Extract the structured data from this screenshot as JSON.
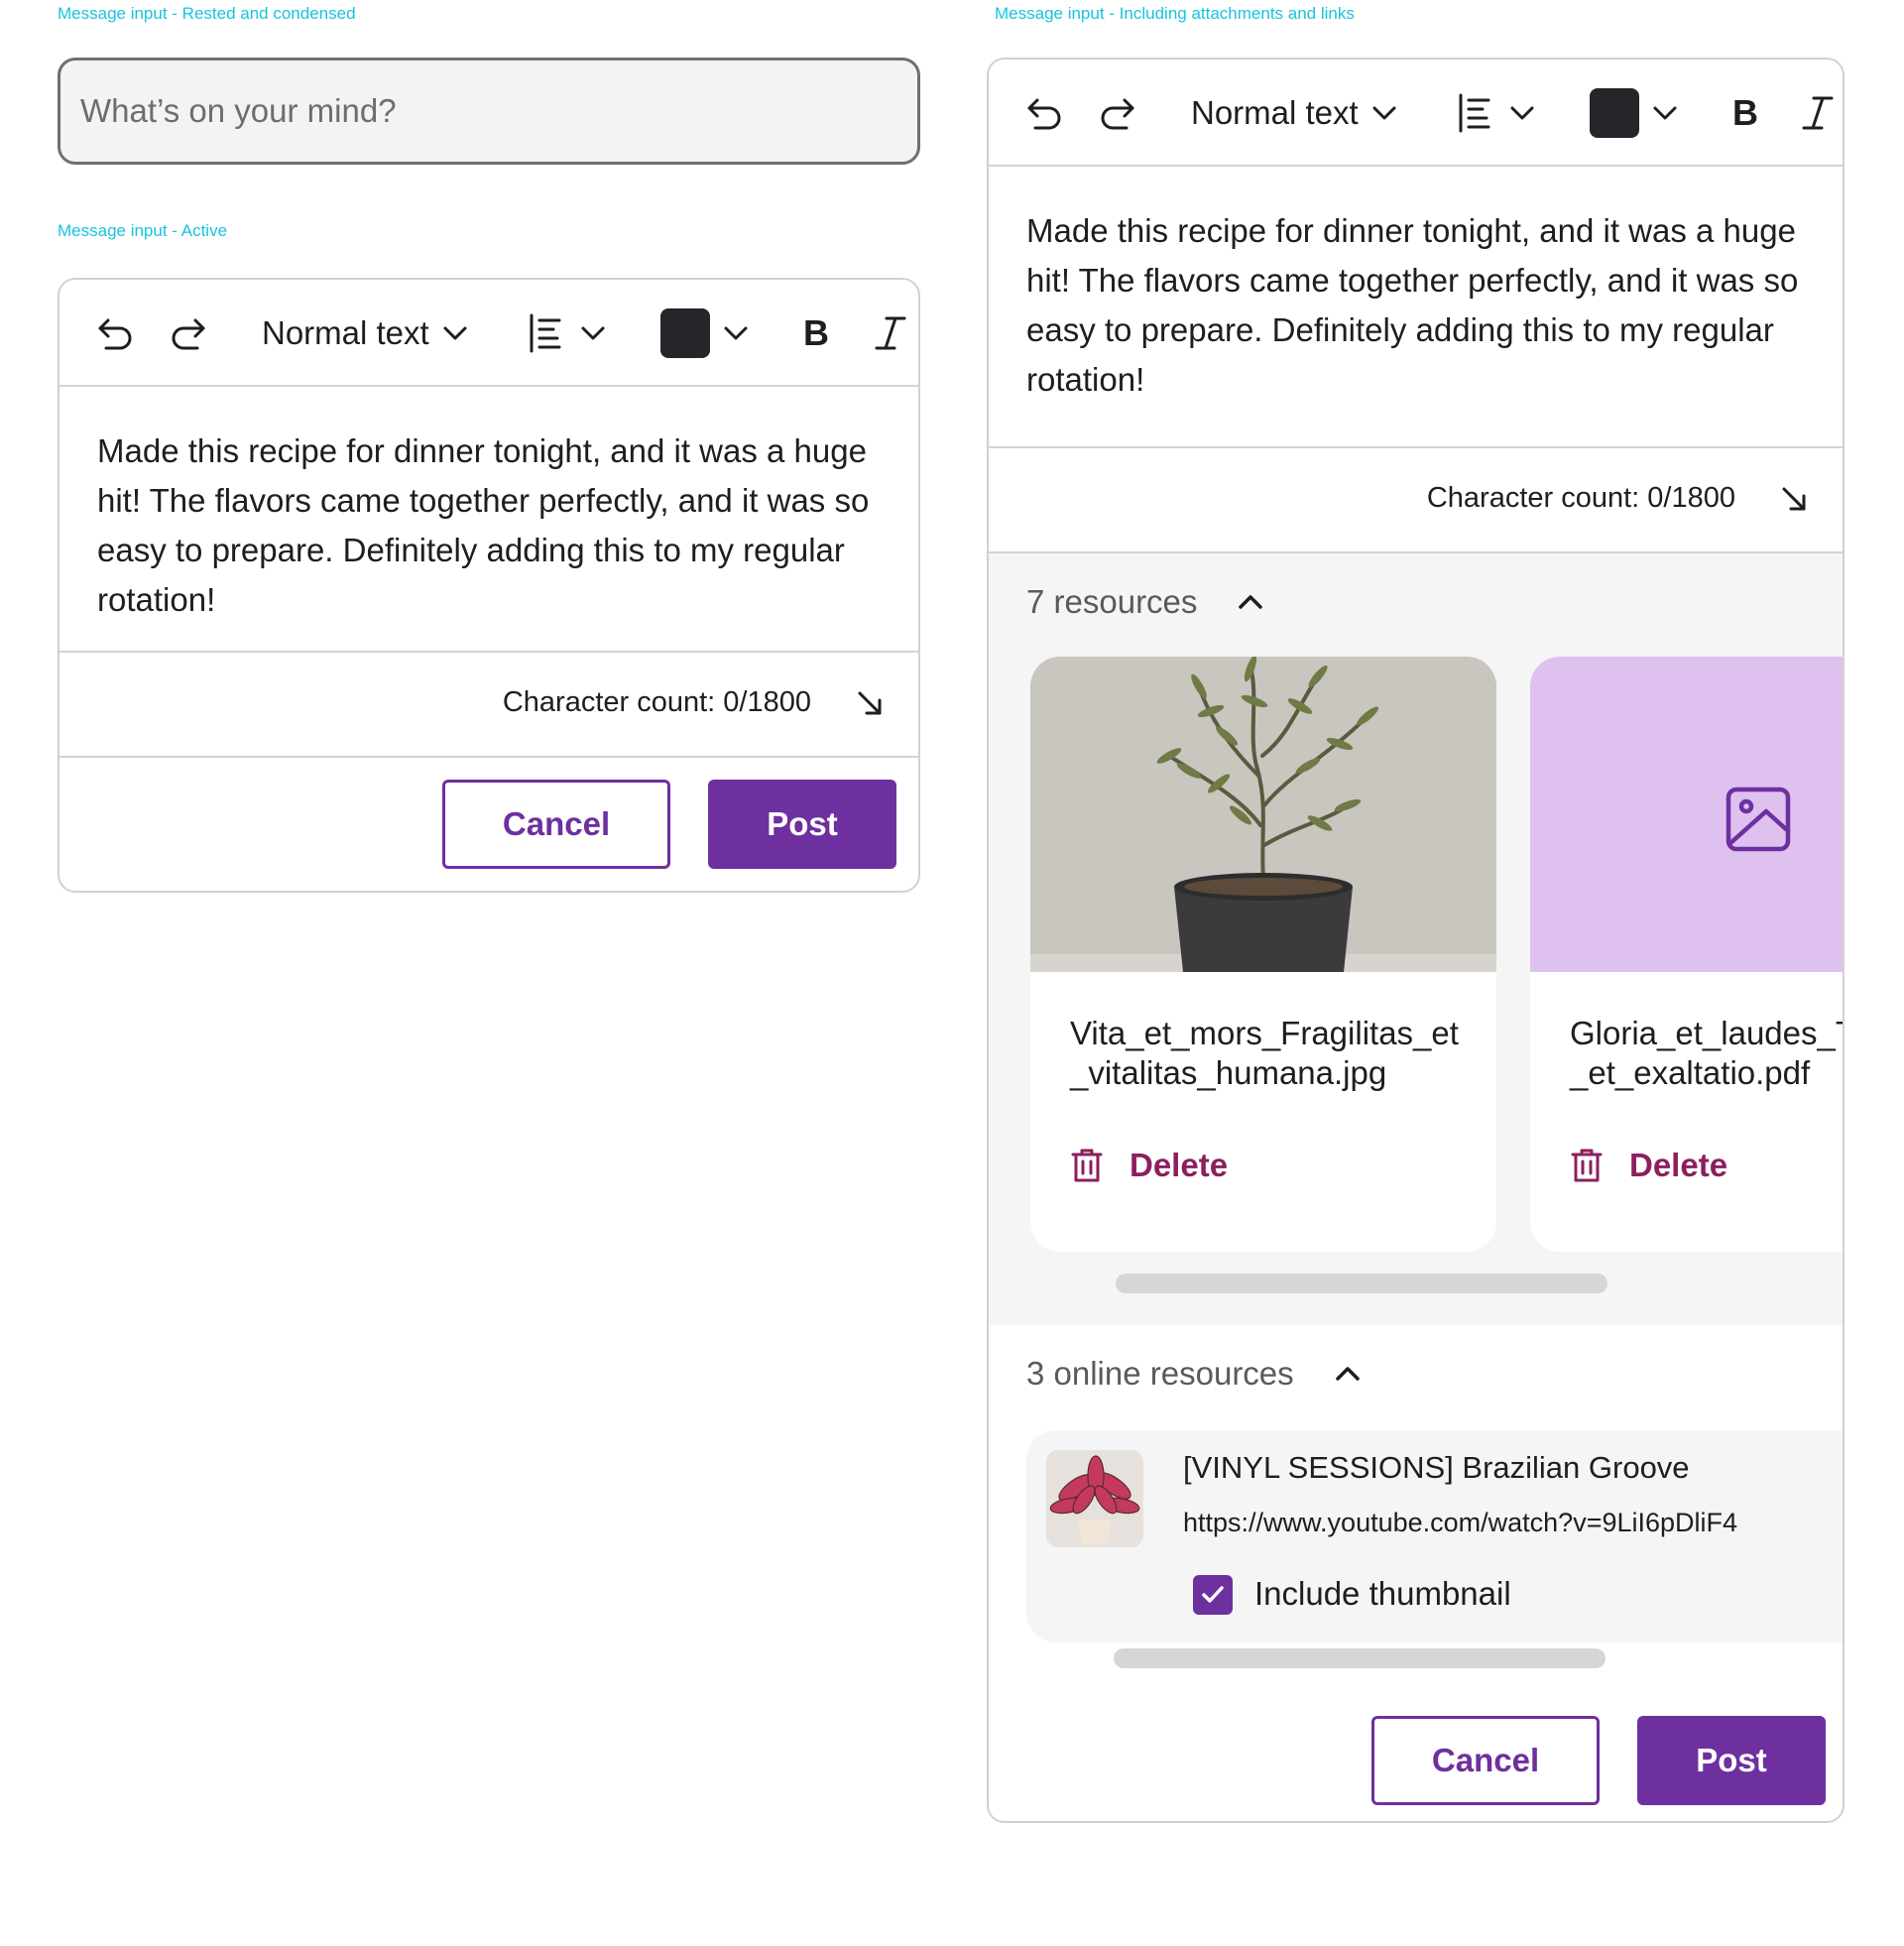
{
  "labels": {
    "rested": "Message input - Rested and condensed",
    "active": "Message input - Active",
    "attachments": "Message input - Including attachments and links"
  },
  "rested_input": {
    "placeholder": "What’s on your mind?"
  },
  "toolbar": {
    "text_style": "Normal text",
    "bold": "B",
    "italic": "I",
    "text_color": "#25252a"
  },
  "message": {
    "lines": [
      "Made this recipe for dinner tonight, and it was a huge",
      "hit! The flavors came together perfectly, and it was so",
      "easy to prepare. Definitely adding this to my regular",
      "rotation!"
    ]
  },
  "char_count": "Character count: 0/1800",
  "buttons": {
    "cancel": "Cancel",
    "post": "Post"
  },
  "resources": {
    "title": "7 resources",
    "files": [
      {
        "name_line1": "Vita_et_mors_Fragilitas_et",
        "name_line2": "_vitalitas_humana.jpg",
        "thumb": "olive-plant-photo",
        "delete": "Delete"
      },
      {
        "name_line1": "Gloria_et_laudes_T",
        "name_line2": "_et_exaltatio.pdf",
        "thumb": "image-placeholder-icon",
        "delete": "Delete"
      }
    ]
  },
  "online_resources": {
    "title": "3 online resources",
    "items": [
      {
        "title": "[VINYL SESSIONS] Brazilian Groove",
        "url": "https://www.youtube.com/watch?v=9LiI6pDliF4",
        "include_thumbnail_label": "Include thumbnail",
        "include_thumbnail": true,
        "thumb": "calathea-plant-photo"
      }
    ]
  },
  "colors": {
    "accent": "#6e2f9f",
    "danger": "#8c1f5f",
    "spec_label": "#18c4de",
    "pdf_thumb_bg": "#dfc1ef"
  }
}
